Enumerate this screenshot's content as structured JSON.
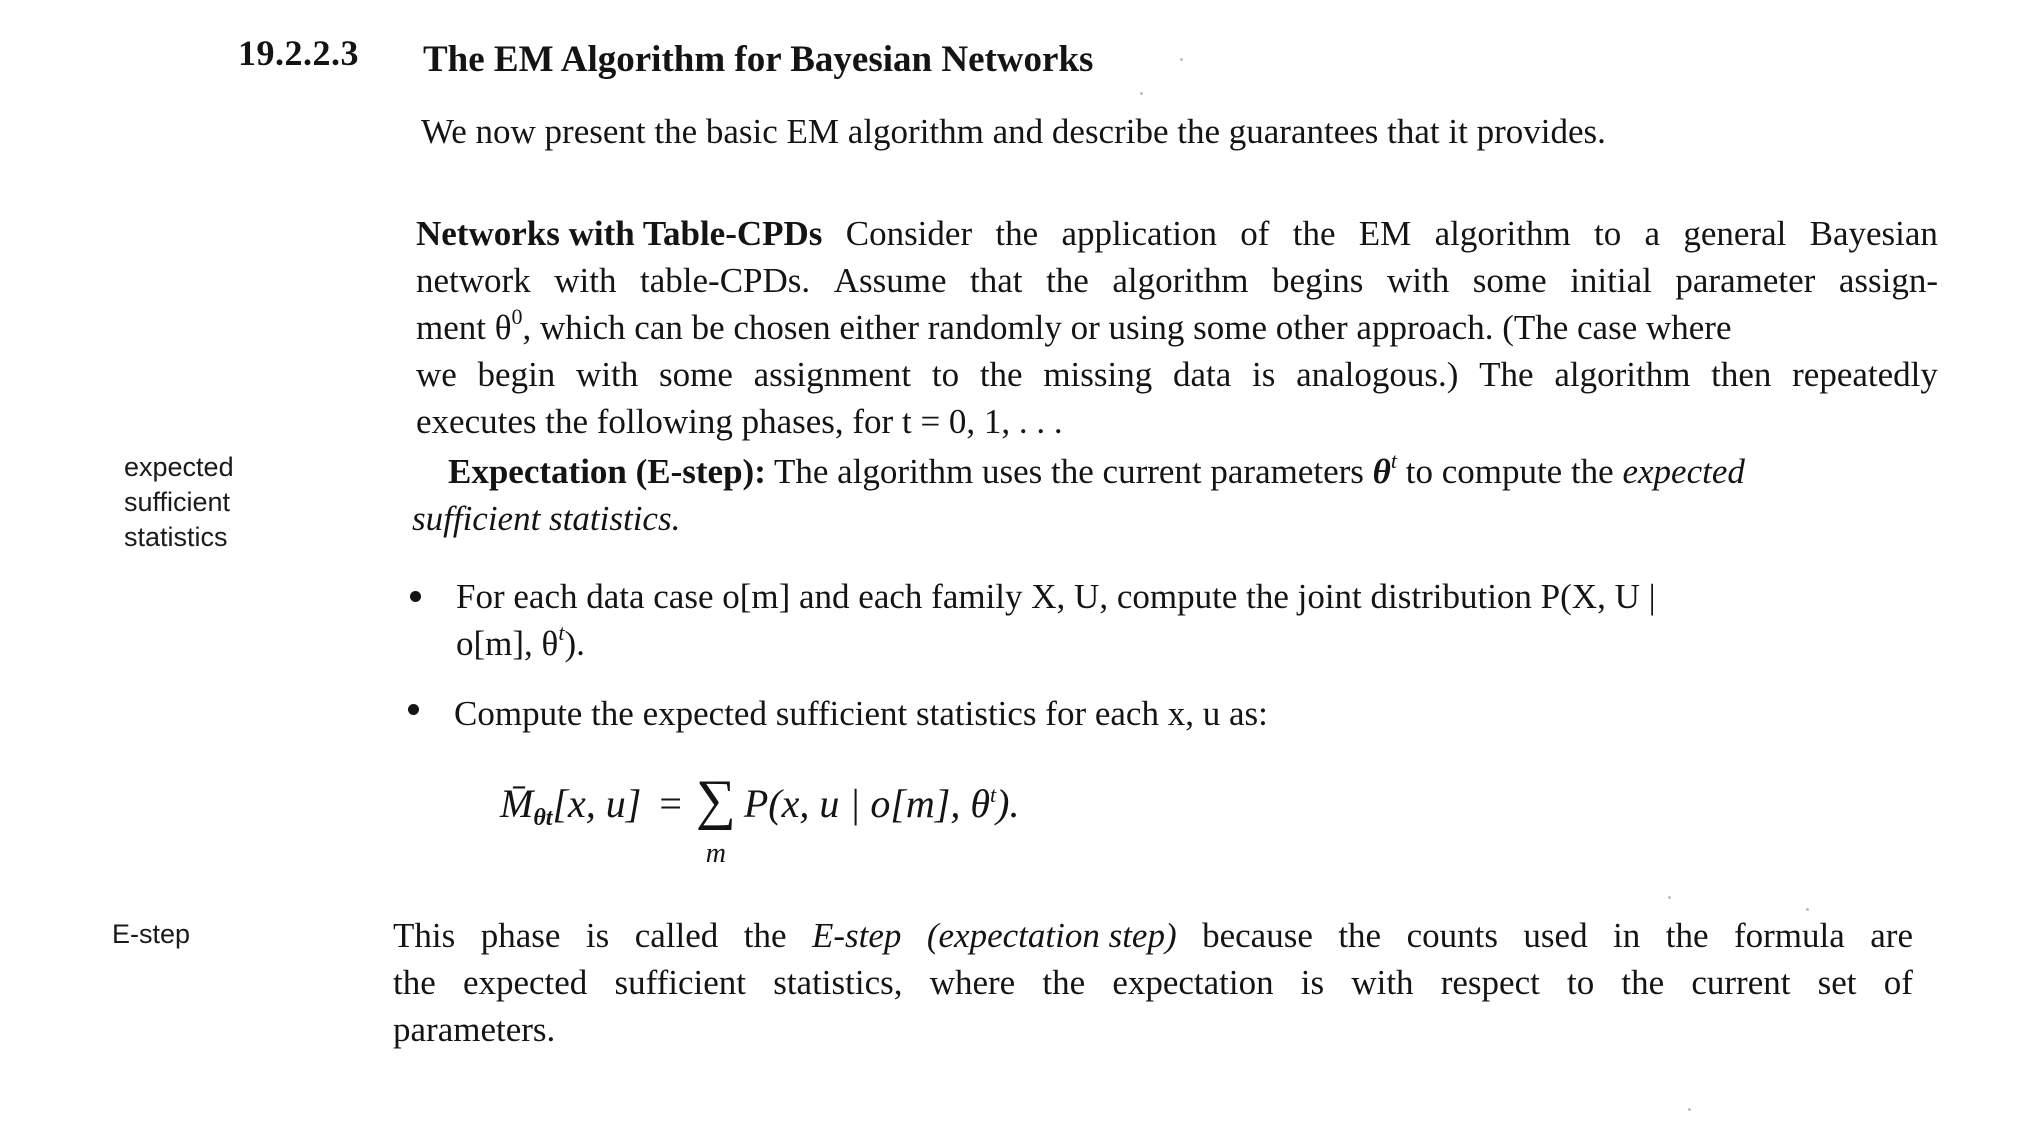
{
  "section": {
    "number": "19.2.2.3",
    "title": "The EM Algorithm for Bayesian Networks"
  },
  "intro": "We now present the basic EM algorithm and describe the guarantees that it provides.",
  "paragraph1": {
    "run_in_heading": "Networks with Table-CPDs",
    "line1": [
      "Consider",
      "the",
      "application",
      "of",
      "the",
      "EM",
      "algorithm",
      "to",
      "a",
      "general",
      "Bayesian"
    ],
    "line2": [
      "network",
      "with",
      "table-CPDs.",
      "Assume",
      "that",
      "the",
      "algorithm",
      "begins",
      "with",
      "some",
      "initial",
      "parameter",
      "assign-"
    ],
    "line3_a": "ment θ",
    "line3_sup": "0",
    "line3_b": ", which can be chosen either randomly or using some other approach. (The case where",
    "line4": [
      "we",
      "begin",
      "with",
      "some",
      "assignment",
      "to",
      "the",
      "missing",
      "data",
      "is",
      "analogous.)",
      "The",
      "algorithm",
      "then",
      "repeatedly"
    ],
    "line5": "executes the following phases, for t = 0, 1, . . ."
  },
  "estep_paragraph": {
    "heading": "Expectation (E-step):",
    "text_a": "The algorithm uses the current parameters",
    "theta": "θ",
    "sup_t": "t",
    "text_b": "to compute the",
    "italic_a": "expected",
    "italic_b": "sufficient statistics."
  },
  "margin_notes": {
    "expected_sufficient_statistics": [
      "expected",
      "sufficient",
      "statistics"
    ],
    "estep": "E-step"
  },
  "bullets": [
    {
      "line1": "For each data case o[m] and each family X, U, compute the joint distribution P(X, U |",
      "line2": "o[m], θ",
      "line2_sup": "t",
      "line2_end": ")."
    },
    {
      "text": "Compute the expected sufficient statistics for each x, u as:"
    }
  ],
  "equation": {
    "lhs_M": "M̄",
    "lhs_sub": "θt",
    "lhs_args": "[x, u]",
    "equals": "=",
    "sigma": "∑",
    "sigma_sub": "m",
    "rhs": "P(x, u | o[m], θ",
    "rhs_sup": "t",
    "rhs_end": ")."
  },
  "paragraph3": {
    "line1": [
      "This",
      "phase",
      "is",
      "called",
      "the",
      "E-step",
      "(expectation step)",
      "because",
      "the",
      "counts",
      "used",
      "in",
      "the",
      "formula",
      "are"
    ],
    "line2": [
      "the",
      "expected",
      "sufficient",
      "statistics,",
      "where",
      "the",
      "expectation",
      "is",
      "with",
      "respect",
      "to",
      "the",
      "current",
      "set",
      "of"
    ],
    "line3": "parameters."
  }
}
